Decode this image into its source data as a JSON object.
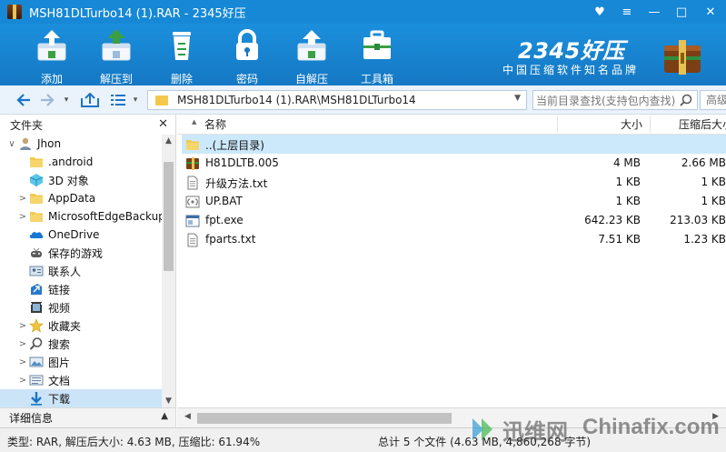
{
  "window": {
    "title": "MSH81DLTurbo14 (1).RAR - 2345好压",
    "controls": {
      "skin": "♥",
      "menu": "≡",
      "minimize": "—",
      "maximize": "□",
      "close": "✕"
    }
  },
  "toolbar": {
    "tools": [
      {
        "id": "add",
        "label": "添加",
        "icon": "add-archive-icon"
      },
      {
        "id": "extract",
        "label": "解压到",
        "icon": "extract-to-icon"
      },
      {
        "id": "delete",
        "label": "删除",
        "icon": "recycle-bin-icon"
      },
      {
        "id": "password",
        "label": "密码",
        "icon": "lock-icon"
      },
      {
        "id": "sfx",
        "label": "自解压",
        "icon": "self-extract-icon"
      },
      {
        "id": "toolbox",
        "label": "工具箱",
        "icon": "toolbox-icon"
      }
    ],
    "brand_name": "2345好压",
    "brand_slogan": "中国压缩软件知名品牌"
  },
  "address_bar": {
    "path": "MSH81DLTurbo14 (1).RAR\\MSH81DLTurbo14",
    "search_placeholder": "当前目录查找(支持包内查找)",
    "advanced_label": "高级"
  },
  "left_pane": {
    "header": "文件夹",
    "close_glyph": "✕",
    "tree": [
      {
        "label": "Jhon",
        "level": 0,
        "expander": "open",
        "icon": "user-folder-icon"
      },
      {
        "label": ".android",
        "level": 1,
        "expander": "none",
        "icon": "folder-icon"
      },
      {
        "label": "3D 对象",
        "level": 1,
        "expander": "none",
        "icon": "3d-objects-icon"
      },
      {
        "label": "AppData",
        "level": 1,
        "expander": "closed",
        "icon": "folder-icon"
      },
      {
        "label": "MicrosoftEdgeBackups",
        "level": 1,
        "expander": "closed",
        "icon": "folder-icon"
      },
      {
        "label": "OneDrive",
        "level": 1,
        "expander": "none",
        "icon": "onedrive-icon"
      },
      {
        "label": "保存的游戏",
        "level": 1,
        "expander": "none",
        "icon": "saved-games-icon"
      },
      {
        "label": "联系人",
        "level": 1,
        "expander": "none",
        "icon": "contacts-icon"
      },
      {
        "label": "链接",
        "level": 1,
        "expander": "none",
        "icon": "links-icon"
      },
      {
        "label": "视频",
        "level": 1,
        "expander": "none",
        "icon": "videos-icon"
      },
      {
        "label": "收藏夹",
        "level": 1,
        "expander": "closed",
        "icon": "favorites-icon"
      },
      {
        "label": "搜索",
        "level": 1,
        "expander": "closed",
        "icon": "search-icon"
      },
      {
        "label": "图片",
        "level": 1,
        "expander": "closed",
        "icon": "pictures-icon"
      },
      {
        "label": "文档",
        "level": 1,
        "expander": "closed",
        "icon": "documents-icon"
      },
      {
        "label": "下载",
        "level": 1,
        "expander": "none",
        "icon": "downloads-icon",
        "selected": true
      }
    ],
    "detail_label": "详细信息"
  },
  "file_list": {
    "columns": {
      "name": "名称",
      "size": "大小",
      "compressed": "压缩后大小"
    },
    "rows": [
      {
        "name": "..(上层目录)",
        "size": "",
        "compressed": "",
        "icon": "folder-up-icon",
        "selected": true
      },
      {
        "name": "H81DLTB.005",
        "size": "4 MB",
        "compressed": "2.66 MB",
        "icon": "rar-file-icon"
      },
      {
        "name": "升级方法.txt",
        "size": "1 KB",
        "compressed": "1 KB",
        "icon": "text-file-icon"
      },
      {
        "name": "UP.BAT",
        "size": "1 KB",
        "compressed": "1 KB",
        "icon": "batch-file-icon"
      },
      {
        "name": "fpt.exe",
        "size": "642.23 KB",
        "compressed": "213.03 KB",
        "icon": "exe-file-icon"
      },
      {
        "name": "fparts.txt",
        "size": "7.51 KB",
        "compressed": "1.23 KB",
        "icon": "text-file-icon"
      }
    ]
  },
  "status_bar": {
    "left": "类型: RAR, 解压后大小: 4.63 MB, 压缩比: 61.94%",
    "right": "总计 5 个文件 (4.63 MB, 4,860,268 字节)"
  },
  "watermark": {
    "cn": "迅维网",
    "en": "Chinafix.com"
  },
  "colors": {
    "titlebar": "#1688d6",
    "toolbar": "#1b8fdc",
    "selection": "#cce8fb",
    "folder": "#f2c94c"
  }
}
